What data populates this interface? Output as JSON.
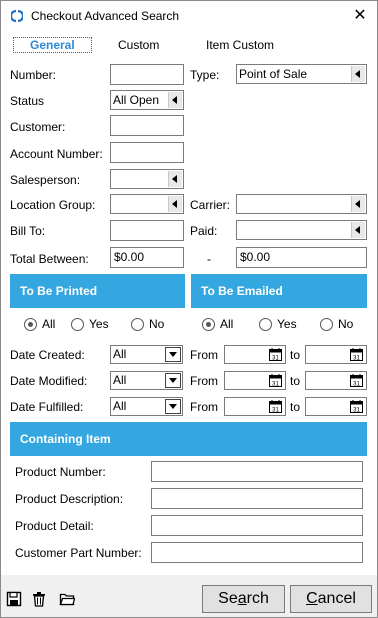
{
  "window": {
    "title": "Checkout Advanced Search",
    "close_glyph": "✕"
  },
  "tabs": [
    {
      "label": "General",
      "active": true
    },
    {
      "label": "Custom",
      "active": false
    },
    {
      "label": "Item Custom",
      "active": false
    }
  ],
  "form": {
    "number_label": "Number:",
    "number_value": "",
    "type_label": "Type:",
    "type_value": "Point of Sale",
    "status_label": "Status",
    "status_value": "All Open",
    "customer_label": "Customer:",
    "customer_value": "",
    "account_number_label": "Account Number:",
    "account_number_value": "",
    "salesperson_label": "Salesperson:",
    "salesperson_value": "",
    "location_group_label": "Location Group:",
    "location_group_value": "",
    "carrier_label": "Carrier:",
    "carrier_value": "",
    "bill_to_label": "Bill To:",
    "bill_to_value": "",
    "paid_label": "Paid:",
    "paid_value": "",
    "total_between_label": "Total Between:",
    "total_from": "$0.00",
    "total_dash": "-",
    "total_to": "$0.00"
  },
  "to_be_printed": {
    "header": "To Be Printed",
    "options": [
      "All",
      "Yes",
      "No"
    ],
    "selected": "All"
  },
  "to_be_emailed": {
    "header": "To Be Emailed",
    "options": [
      "All",
      "Yes",
      "No"
    ],
    "selected": "All"
  },
  "dates": {
    "from_label": "From",
    "to_label": "to",
    "rows": [
      {
        "label": "Date Created:",
        "value": "All"
      },
      {
        "label": "Date Modified:",
        "value": "All"
      },
      {
        "label": "Date Fulfilled:",
        "value": "All"
      }
    ]
  },
  "containing_item": {
    "header": "Containing Item",
    "fields": [
      {
        "label": "Product Number:",
        "value": ""
      },
      {
        "label": "Product Description:",
        "value": ""
      },
      {
        "label": "Product Detail:",
        "value": ""
      },
      {
        "label": "Customer Part Number:",
        "value": ""
      }
    ]
  },
  "footer": {
    "icons": [
      "save-icon",
      "delete-icon",
      "open-folder-icon"
    ],
    "search_prefix": "Se",
    "search_underlined": "a",
    "search_suffix": "rch",
    "cancel_underlined": "C",
    "cancel_suffix": "ancel"
  },
  "colors": {
    "accent_band": "#35a7e0",
    "active_tab": "#2d8ad6"
  }
}
